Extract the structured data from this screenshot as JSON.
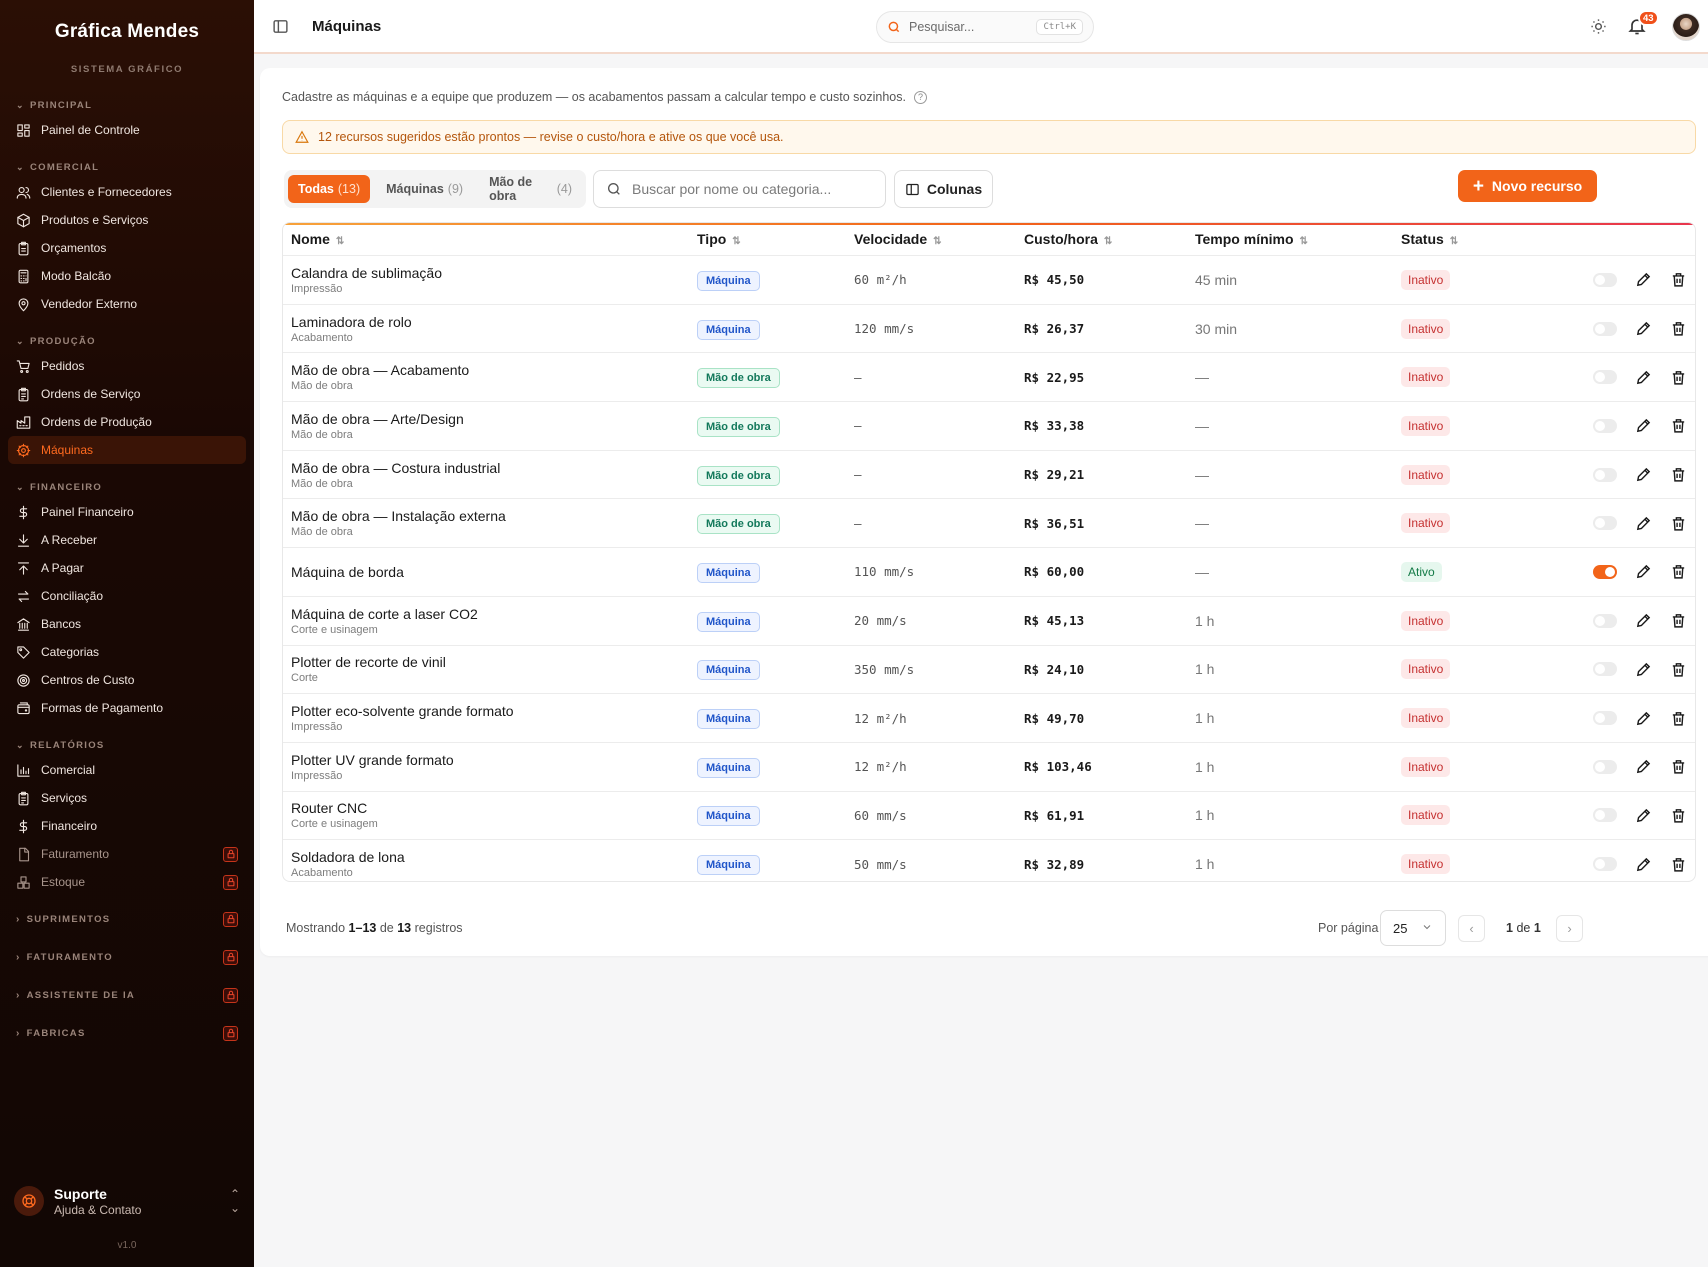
{
  "brand": {
    "name": "Gráfica Mendes",
    "subtitle": "SISTEMA GRÁFICO"
  },
  "sidebar": {
    "sections": [
      {
        "label": "PRINCIPAL",
        "items": [
          {
            "label": "Painel de Controle",
            "icon": "dashboard-icon"
          }
        ]
      },
      {
        "label": "COMERCIAL",
        "items": [
          {
            "label": "Clientes e Fornecedores",
            "icon": "users-icon"
          },
          {
            "label": "Produtos e Serviços",
            "icon": "package-icon"
          },
          {
            "label": "Orçamentos",
            "icon": "clipboard-icon"
          },
          {
            "label": "Modo Balcão",
            "icon": "calculator-icon"
          },
          {
            "label": "Vendedor Externo",
            "icon": "map-pin-icon"
          }
        ]
      },
      {
        "label": "PRODUÇÃO",
        "items": [
          {
            "label": "Pedidos",
            "icon": "cart-icon"
          },
          {
            "label": "Ordens de Serviço",
            "icon": "clipboard-list-icon"
          },
          {
            "label": "Ordens de Produção",
            "icon": "factory-icon"
          },
          {
            "label": "Máquinas",
            "icon": "cog-icon",
            "active": true
          }
        ]
      },
      {
        "label": "FINANCEIRO",
        "items": [
          {
            "label": "Painel Financeiro",
            "icon": "dollar-icon"
          },
          {
            "label": "A Receber",
            "icon": "download-icon"
          },
          {
            "label": "A Pagar",
            "icon": "upload-icon"
          },
          {
            "label": "Conciliação",
            "icon": "swap-icon"
          },
          {
            "label": "Bancos",
            "icon": "bank-icon"
          },
          {
            "label": "Categorias",
            "icon": "tag-icon"
          },
          {
            "label": "Centros de Custo",
            "icon": "target-icon"
          },
          {
            "label": "Formas de Pagamento",
            "icon": "wallet-icon"
          }
        ]
      },
      {
        "label": "RELATÓRIOS",
        "items": [
          {
            "label": "Comercial",
            "icon": "bar-chart-icon"
          },
          {
            "label": "Serviços",
            "icon": "clipboard-list-icon"
          },
          {
            "label": "Financeiro",
            "icon": "dollar-icon"
          },
          {
            "label": "Faturamento",
            "icon": "file-icon",
            "locked": true
          },
          {
            "label": "Estoque",
            "icon": "boxes-icon",
            "locked": true
          }
        ]
      }
    ],
    "locked_sections": [
      "SUPRIMENTOS",
      "FATURAMENTO",
      "ASSISTENTE DE IA",
      "FABRICAS"
    ],
    "support": {
      "title": "Suporte",
      "subtitle": "Ajuda & Contato"
    },
    "version": "v1.0"
  },
  "topbar": {
    "title": "Máquinas",
    "search_placeholder": "Pesquisar...",
    "search_shortcut": "Ctrl+K",
    "notifications": "43"
  },
  "page": {
    "intro": "Cadastre as máquinas e a equipe que produzem — os acabamentos passam a calcular tempo e custo sozinhos.",
    "alert": "12 recursos sugeridos estão prontos — revise o custo/hora e ative os que você usa.",
    "filters": [
      {
        "label": "Todas",
        "count": "(13)",
        "active": true
      },
      {
        "label": "Máquinas",
        "count": "(9)"
      },
      {
        "label": "Mão de obra",
        "count": "(4)"
      }
    ],
    "search_placeholder": "Buscar por nome ou categoria...",
    "columns_button": "Colunas",
    "new_button": "Novo recurso"
  },
  "table": {
    "headers": [
      "Nome",
      "Tipo",
      "Velocidade",
      "Custo/hora",
      "Tempo mínimo",
      "Status"
    ],
    "rows": [
      {
        "name": "Calandra de sublimação",
        "category": "Impressão",
        "type": "Máquina",
        "speed": "60 m²/h",
        "cost": "R$ 45,50",
        "min": "45 min",
        "status": "Inativo",
        "on": false
      },
      {
        "name": "Laminadora de rolo",
        "category": "Acabamento",
        "type": "Máquina",
        "speed": "120 mm/s",
        "cost": "R$ 26,37",
        "min": "30 min",
        "status": "Inativo",
        "on": false
      },
      {
        "name": "Mão de obra — Acabamento",
        "category": "Mão de obra",
        "type": "Mão de obra",
        "speed": "—",
        "cost": "R$ 22,95",
        "min": "—",
        "status": "Inativo",
        "on": false
      },
      {
        "name": "Mão de obra — Arte/Design",
        "category": "Mão de obra",
        "type": "Mão de obra",
        "speed": "—",
        "cost": "R$ 33,38",
        "min": "—",
        "status": "Inativo",
        "on": false
      },
      {
        "name": "Mão de obra — Costura industrial",
        "category": "Mão de obra",
        "type": "Mão de obra",
        "speed": "—",
        "cost": "R$ 29,21",
        "min": "—",
        "status": "Inativo",
        "on": false
      },
      {
        "name": "Mão de obra — Instalação externa",
        "category": "Mão de obra",
        "type": "Mão de obra",
        "speed": "—",
        "cost": "R$ 36,51",
        "min": "—",
        "status": "Inativo",
        "on": false
      },
      {
        "name": "Máquina de borda",
        "category": "",
        "type": "Máquina",
        "speed": "110 mm/s",
        "cost": "R$ 60,00",
        "min": "—",
        "status": "Ativo",
        "on": true
      },
      {
        "name": "Máquina de corte a laser CO2",
        "category": "Corte e usinagem",
        "type": "Máquina",
        "speed": "20 mm/s",
        "cost": "R$ 45,13",
        "min": "1 h",
        "status": "Inativo",
        "on": false
      },
      {
        "name": "Plotter de recorte de vinil",
        "category": "Corte",
        "type": "Máquina",
        "speed": "350 mm/s",
        "cost": "R$ 24,10",
        "min": "1 h",
        "status": "Inativo",
        "on": false
      },
      {
        "name": "Plotter eco-solvente grande formato",
        "category": "Impressão",
        "type": "Máquina",
        "speed": "12 m²/h",
        "cost": "R$ 49,70",
        "min": "1 h",
        "status": "Inativo",
        "on": false
      },
      {
        "name": "Plotter UV grande formato",
        "category": "Impressão",
        "type": "Máquina",
        "speed": "12 m²/h",
        "cost": "R$ 103,46",
        "min": "1 h",
        "status": "Inativo",
        "on": false
      },
      {
        "name": "Router CNC",
        "category": "Corte e usinagem",
        "type": "Máquina",
        "speed": "60 mm/s",
        "cost": "R$ 61,91",
        "min": "1 h",
        "status": "Inativo",
        "on": false
      },
      {
        "name": "Soldadora de lona",
        "category": "Acabamento",
        "type": "Máquina",
        "speed": "50 mm/s",
        "cost": "R$ 32,89",
        "min": "1 h",
        "status": "Inativo",
        "on": false
      }
    ]
  },
  "pagination": {
    "showing_prefix": "Mostrando",
    "range": "1–13",
    "of": "de",
    "total": "13",
    "suffix": "registros",
    "per_page_label": "Por página",
    "per_page": "25",
    "page": "1",
    "page_of": "de",
    "pages": "1"
  },
  "colors": {
    "accent": "#f26419",
    "sidebar_bg": "#1a0804",
    "active_bg": "#3a1406"
  }
}
